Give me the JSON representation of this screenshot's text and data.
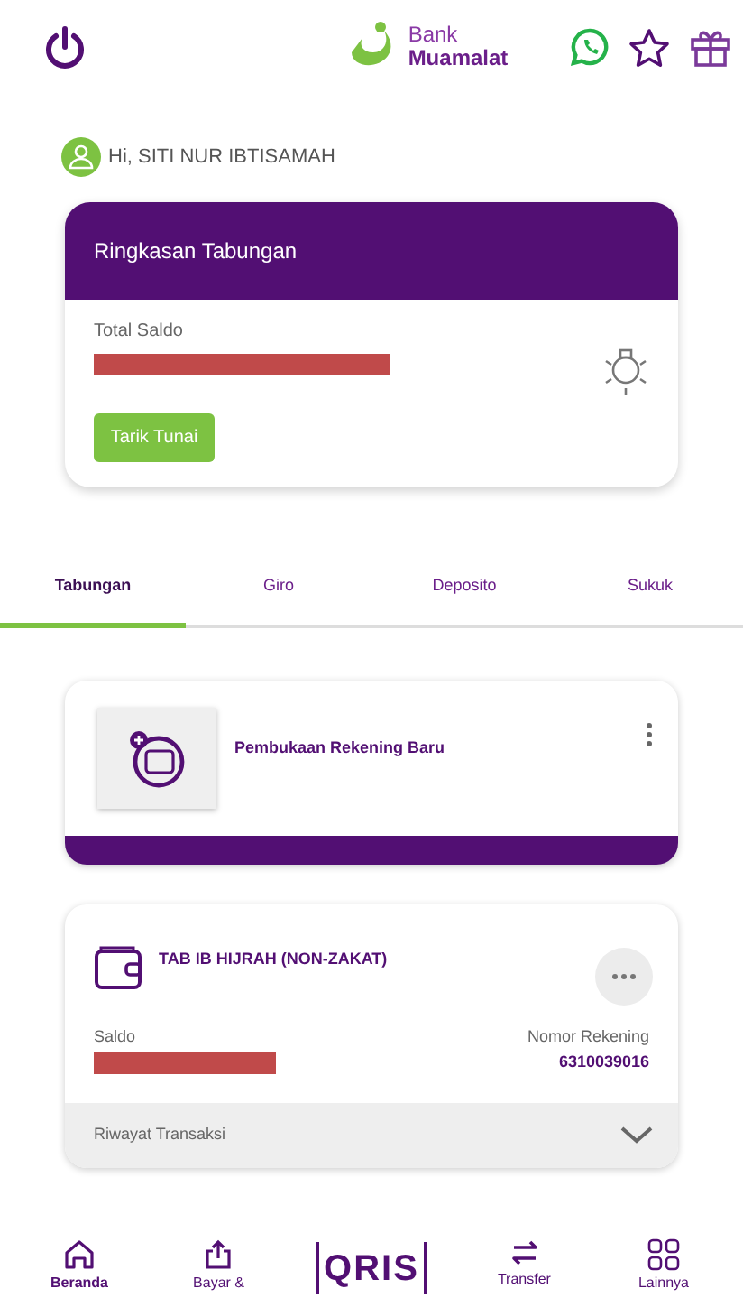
{
  "header": {
    "logo_line1": "Bank",
    "logo_line2": "Muamalat"
  },
  "greeting": "Hi, SITI NUR IBTISAMAH",
  "summary_card": {
    "title": "Ringkasan Tabungan",
    "balance_label": "Total Saldo",
    "button": "Tarik Tunai"
  },
  "tabs": [
    {
      "label": "Tabungan",
      "selected": true
    },
    {
      "label": "Giro",
      "selected": false
    },
    {
      "label": "Deposito",
      "selected": false
    },
    {
      "label": "Sukuk",
      "selected": false
    }
  ],
  "new_account_card": {
    "label": "Pembukaan Rekening Baru"
  },
  "account_card": {
    "name": "TAB IB HIJRAH (NON-ZAKAT)",
    "balance_label": "Saldo",
    "number_label": "Nomor Rekening",
    "number": "6310039016",
    "history": "Riwayat Transaksi",
    "expanded": false
  },
  "bottom_nav": [
    {
      "kind": "home",
      "label": "Beranda",
      "selected": true
    },
    {
      "kind": "upload",
      "label": "Bayar &",
      "selected": false
    },
    {
      "kind": "qris",
      "label": "QRIS",
      "selected": false
    },
    {
      "kind": "transfer",
      "label": "Transfer",
      "selected": false
    },
    {
      "kind": "grid",
      "label": "Lainnya",
      "selected": false
    }
  ]
}
